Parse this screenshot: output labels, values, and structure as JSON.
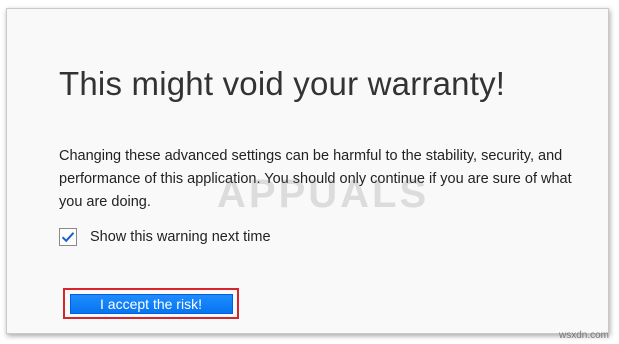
{
  "dialog": {
    "title": "This might void your warranty!",
    "message": "Changing these advanced settings can be harmful to the stability, security, and performance of this application. You should only continue if you are sure of what you are doing.",
    "checkbox_label": "Show this warning next time",
    "checkbox_checked": true,
    "accept_button_label": "I accept the risk!",
    "accent_color": "#0a84ff",
    "highlight_color": "#d6252b"
  },
  "watermarks": {
    "center": "APPUALS",
    "corner": "wsxdn.com"
  }
}
